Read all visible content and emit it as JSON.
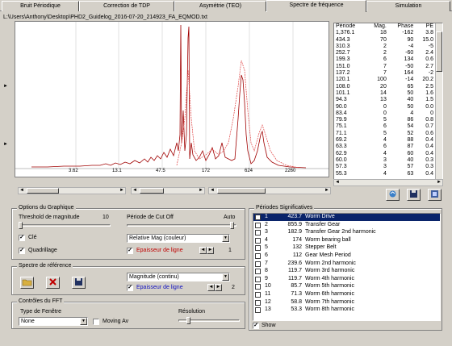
{
  "tabs": [
    "Bruit Périodique",
    "Correction de TDP",
    "Asymétrie (TEO)",
    "Spectre de fréquence",
    "Simulation"
  ],
  "active_tab": 3,
  "file_path": "L:\\Users\\Anthony\\Desktop\\PHD2_Guidelog_2016-07-20_214923_FA_EQMOD.txt",
  "x_ticks": [
    "3.62",
    "13.1",
    "47.5",
    "172",
    "624",
    "2260"
  ],
  "table": {
    "headers": [
      "Période",
      "Mag.",
      "Phase",
      "PE"
    ],
    "rows": [
      [
        "1,376.1",
        "18",
        "-162",
        "3.8"
      ],
      [
        "434.3",
        "70",
        "90",
        "15.0"
      ],
      [
        "310.3",
        "2",
        "-4",
        "-5"
      ],
      [
        "252.7",
        "2",
        "-60",
        "2.4"
      ],
      [
        "199.3",
        "6",
        "134",
        "0.6"
      ],
      [
        "151.0",
        "7",
        "-50",
        "2.7"
      ],
      [
        "137.2",
        "7",
        "164",
        "-2"
      ],
      [
        "120.1",
        "100",
        "-14",
        "20.2"
      ],
      [
        "108.0",
        "20",
        "65",
        "2.5"
      ],
      [
        "101.1",
        "14",
        "50",
        "1.6"
      ],
      [
        "94.3",
        "13",
        "40",
        "1.5"
      ],
      [
        "90.0",
        "0",
        "50",
        "0.0"
      ],
      [
        "83.4",
        "0",
        "4",
        "0"
      ],
      [
        "79.9",
        "5",
        "86",
        "0.8"
      ],
      [
        "75.1",
        "6",
        "54",
        "0.7"
      ],
      [
        "71.1",
        "5",
        "52",
        "0.6"
      ],
      [
        "69.2",
        "4",
        "88",
        "0.4"
      ],
      [
        "63.3",
        "6",
        "87",
        "0.4"
      ],
      [
        "62.9",
        "4",
        "60",
        "0.4"
      ],
      [
        "60.0",
        "3",
        "40",
        "0.3"
      ],
      [
        "57.3",
        "3",
        "57",
        "0.3"
      ],
      [
        "55.3",
        "4",
        "63",
        "0.4"
      ]
    ]
  },
  "graph_options": {
    "title": "Options du Graphique",
    "threshold_label": "Threshold de magnitude",
    "threshold_value": "10",
    "period_label": "Période de Cut Off",
    "period_value": "Auto",
    "grid_label": "Clé",
    "quadrillage_label": "Quadrillage",
    "relative_select": "Relative Mag (couleur)",
    "thickness_label": "Epaisseur de ligne",
    "thickness_value": "1"
  },
  "reference": {
    "title": "Spectre de référence",
    "select": "Magnitude (continu)",
    "thickness_label": "Epaisseur de ligne",
    "thickness_value": "2"
  },
  "fft": {
    "title": "Contrôles du FFT",
    "window_label": "Type de Fenêtre",
    "window_value": "None",
    "moving_label": "Moving Av",
    "resolution_label": "Résolution"
  },
  "periods": {
    "title": "Périodes Significatives",
    "show_label": "Show",
    "rows": [
      [
        "1",
        "423.7",
        "Worm Drive"
      ],
      [
        "2",
        "855.9",
        "Transfer Gear"
      ],
      [
        "3",
        "182.9",
        "Transfer Gear 2nd harmonic"
      ],
      [
        "4",
        "174",
        "Worm bearing ball"
      ],
      [
        "5",
        "132",
        "Stepper Belt"
      ],
      [
        "6",
        "112",
        "Gear Mesh Period"
      ],
      [
        "7",
        "239.6",
        "Worm 2nd harmonic"
      ],
      [
        "8",
        "119.7",
        "Worm 3rd harmonic"
      ],
      [
        "9",
        "119.7",
        "Worm 4th harmonic"
      ],
      [
        "10",
        "85.7",
        "Worm 5th harmonic"
      ],
      [
        "11",
        "71.3",
        "Worm 6th harmonic"
      ],
      [
        "12",
        "58.8",
        "Worm 7th harmonic"
      ],
      [
        "13",
        "53.3",
        "Worm 8th harmonic"
      ]
    ]
  }
}
